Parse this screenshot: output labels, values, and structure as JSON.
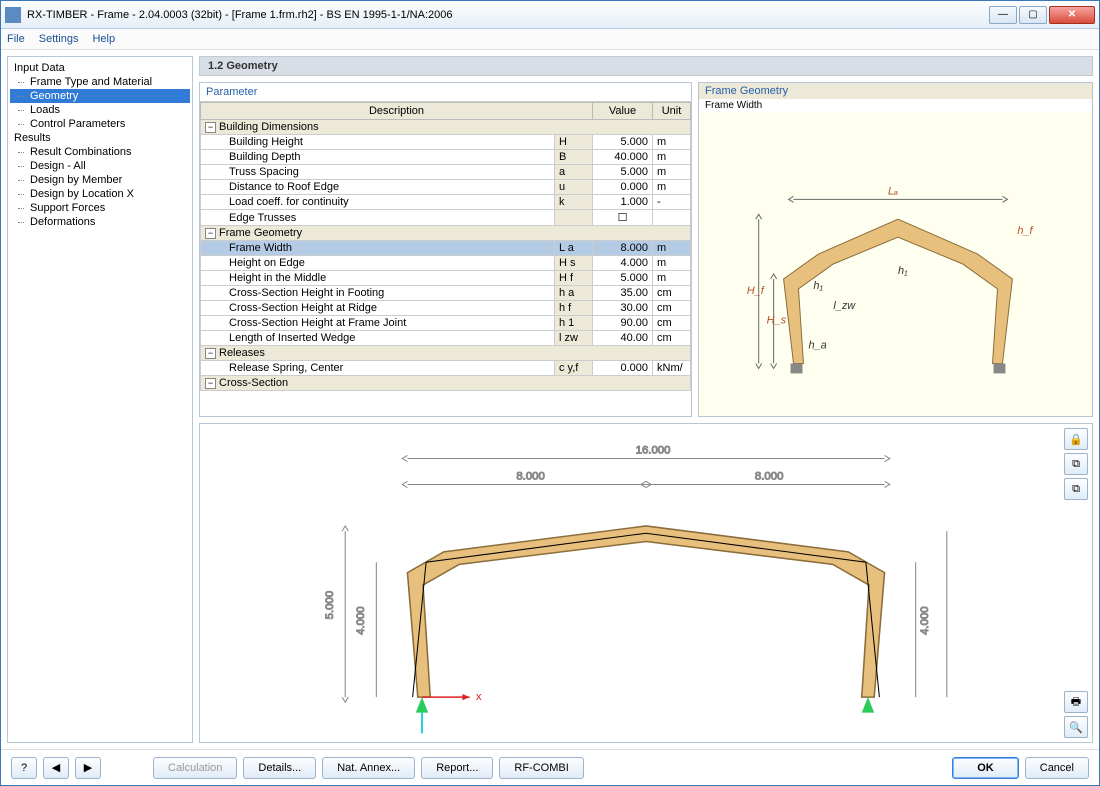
{
  "window": {
    "title": "RX-TIMBER - Frame - 2.04.0003 (32bit) - [Frame 1.frm.rh2] - BS EN 1995-1-1/NA:2006"
  },
  "menu": {
    "file": "File",
    "settings": "Settings",
    "help": "Help"
  },
  "tree": {
    "input": "Input Data",
    "frame_type": "Frame Type and Material",
    "geometry": "Geometry",
    "loads": "Loads",
    "control": "Control Parameters",
    "results": "Results",
    "result_comb": "Result Combinations",
    "design_all": "Design - All",
    "design_member": "Design by Member",
    "design_locx": "Design by Location X",
    "support": "Support Forces",
    "deform": "Deformations"
  },
  "panel_title": "1.2 Geometry",
  "param_caption": "Parameter",
  "headers": {
    "desc": "Description",
    "value": "Value",
    "unit": "Unit"
  },
  "groups": {
    "building": "Building Dimensions",
    "frame_geom": "Frame Geometry",
    "releases": "Releases",
    "cross": "Cross-Section"
  },
  "rows": {
    "bh": {
      "d": "Building Height",
      "s": "H",
      "v": "5.000",
      "u": "m"
    },
    "bd": {
      "d": "Building Depth",
      "s": "B",
      "v": "40.000",
      "u": "m"
    },
    "ts": {
      "d": "Truss Spacing",
      "s": "a",
      "v": "5.000",
      "u": "m"
    },
    "dre": {
      "d": "Distance to Roof Edge",
      "s": "u",
      "v": "0.000",
      "u": "m"
    },
    "lcc": {
      "d": "Load coeff. for continuity",
      "s": "k",
      "v": "1.000",
      "u": "-"
    },
    "et": {
      "d": "Edge Trusses",
      "s": "",
      "v": "",
      "u": ""
    },
    "fw": {
      "d": "Frame Width",
      "s": "L a",
      "v": "8.000",
      "u": "m"
    },
    "he": {
      "d": "Height on Edge",
      "s": "H s",
      "v": "4.000",
      "u": "m"
    },
    "hm": {
      "d": "Height in the Middle",
      "s": "H f",
      "v": "5.000",
      "u": "m"
    },
    "csf": {
      "d": "Cross-Section Height in Footing",
      "s": "h a",
      "v": "35.00",
      "u": "cm"
    },
    "csr": {
      "d": "Cross-Section Height at Ridge",
      "s": "h f",
      "v": "30.00",
      "u": "cm"
    },
    "csj": {
      "d": "Cross-Section Height at Frame Joint",
      "s": "h 1",
      "v": "90.00",
      "u": "cm"
    },
    "liw": {
      "d": "Length of Inserted Wedge",
      "s": "l zw",
      "v": "40.00",
      "u": "cm"
    },
    "rsc": {
      "d": "Release Spring, Center",
      "s": "c y,f",
      "v": "0.000",
      "u": "kNm/"
    }
  },
  "preview": {
    "hdr": "Frame Geometry",
    "sub": "Frame Width",
    "labels": {
      "La": "Lₐ",
      "hf": "h_f",
      "Hf": "H_f",
      "Hs": "H_s",
      "h1": "h₁",
      "lzw": "l_zw",
      "ha": "h_a"
    }
  },
  "lower_dims": {
    "total": "16.000",
    "half": "8.000",
    "height": "5.000",
    "edge": "4.000"
  },
  "buttons": {
    "calc": "Calculation",
    "details": "Details...",
    "annex": "Nat. Annex...",
    "report": "Report...",
    "rfcombi": "RF-COMBI",
    "ok": "OK",
    "cancel": "Cancel"
  }
}
